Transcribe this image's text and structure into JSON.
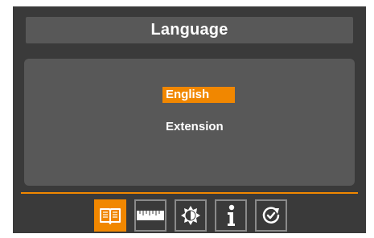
{
  "title": "Language",
  "options": [
    {
      "label": "English",
      "selected": true
    },
    {
      "label": "Extension",
      "selected": false
    }
  ],
  "tabs": [
    {
      "icon": "book-icon",
      "active": true
    },
    {
      "icon": "ruler-icon",
      "active": false
    },
    {
      "icon": "brightness-icon",
      "active": false
    },
    {
      "icon": "info-icon",
      "active": false
    },
    {
      "icon": "reset-icon",
      "active": false
    }
  ],
  "colors": {
    "accent": "#f18700",
    "panel": "#585858",
    "background": "#3a3a3a",
    "text": "#ffffff"
  }
}
